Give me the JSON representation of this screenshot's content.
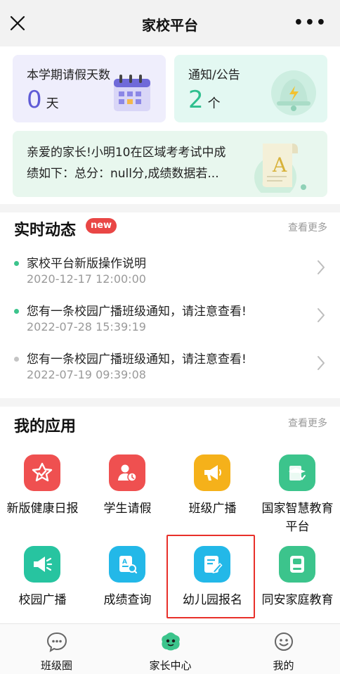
{
  "navbar": {
    "title": "家校平台",
    "more": "•••",
    "close_icon": "close-icon"
  },
  "cards": {
    "leave": {
      "label": "本学期请假天数",
      "value": "0",
      "unit": "天",
      "icon": "calendar-icon"
    },
    "notice": {
      "label": "通知/公告",
      "value": "2",
      "unit": "个",
      "icon": "bell-icon"
    },
    "score": {
      "line1": "亲爱的家长!小明10在区域考考试中成",
      "line2": "绩如下：总分：null分,成绩数据若...",
      "icon": "document-a-icon"
    }
  },
  "feed": {
    "title": "实时动态",
    "badge": "new",
    "more": "查看更多",
    "items": [
      {
        "title": "家校平台新版操作说明",
        "time": "2020-12-17 12:00:00",
        "dot_color": "#3cc48c"
      },
      {
        "title": "您有一条校园广播班级通知，请注意查看!",
        "time": "2022-07-28 15:39:19",
        "dot_color": "#3cc48c"
      },
      {
        "title": "您有一条校园广播班级通知，请注意查看!",
        "time": "2022-07-19 09:39:08",
        "dot_color": "#c4c4c4"
      }
    ]
  },
  "apps": {
    "title": "我的应用",
    "more": "查看更多",
    "items": [
      {
        "label": "新版健康日报",
        "icon": "star-check-icon",
        "color": "#ef5050"
      },
      {
        "label": "学生请假",
        "icon": "person-clock-icon",
        "color": "#ef5050"
      },
      {
        "label": "班级广播",
        "icon": "megaphone-icon",
        "color": "#f5b11a"
      },
      {
        "label": "国家智慧教育\n平台",
        "icon": "graduation-cap-icon",
        "color": "#3cc48c"
      },
      {
        "label": "校园广播",
        "icon": "loudspeaker-icon",
        "color": "#27c4a0"
      },
      {
        "label": "成绩查询",
        "icon": "score-search-icon",
        "color": "#23b8e8"
      },
      {
        "label": "幼儿园报名",
        "icon": "edit-form-icon",
        "color": "#23b8e8"
      },
      {
        "label": "同安家庭教育",
        "icon": "book-icon",
        "color": "#3cc48c"
      }
    ]
  },
  "tabbar": {
    "items": [
      {
        "label": "班级圈",
        "icon": "chat-bubble-icon",
        "active": false
      },
      {
        "label": "家长中心",
        "icon": "parent-mascot-icon",
        "active": true
      },
      {
        "label": "我的",
        "icon": "smiley-icon",
        "active": false
      }
    ]
  },
  "colors": {
    "accent_green": "#3cc48c",
    "accent_purple": "#5f5bd6",
    "highlight_red": "#e8302a"
  }
}
